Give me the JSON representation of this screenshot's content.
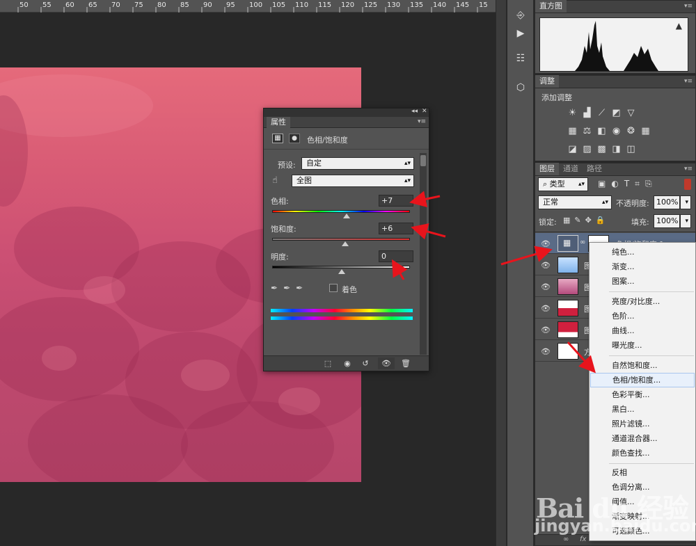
{
  "ruler": {
    "ticks": [
      "50",
      "55",
      "60",
      "65",
      "70",
      "75",
      "80",
      "85",
      "90",
      "95",
      "100",
      "105",
      "110",
      "115",
      "120",
      "125",
      "130",
      "135",
      "140",
      "145",
      "15"
    ]
  },
  "histogram_panel": {
    "tab": "直方图",
    "warning_icon": "warning-icon"
  },
  "adjustments_panel": {
    "tab": "调整",
    "heading": "添加调整"
  },
  "layers_panel": {
    "tabs": [
      "图层",
      "通道",
      "路径"
    ],
    "filter_type": "类型",
    "blend_mode": "正常",
    "opacity_label": "不透明度:",
    "opacity_value": "100%",
    "lock_label": "锁定:",
    "fill_label": "填充:",
    "fill_value": "100%",
    "selected_layer_name": "色相/饱和度 1",
    "layer_names": [
      "图",
      "图",
      "图",
      "图",
      "方"
    ]
  },
  "properties_panel": {
    "tab": "属性",
    "title": "色相/饱和度",
    "preset_label": "预设:",
    "preset_value": "自定",
    "range_value": "全图",
    "hue_label": "色相:",
    "hue_value": "+7",
    "saturation_label": "饱和度:",
    "saturation_value": "+6",
    "lightness_label": "明度:",
    "lightness_value": "0",
    "colorize_label": "着色"
  },
  "context_menu": {
    "group1": [
      "纯色...",
      "渐变...",
      "图案..."
    ],
    "group2": [
      "亮度/对比度...",
      "色阶...",
      "曲线...",
      "曝光度..."
    ],
    "group3": [
      "自然饱和度...",
      "色相/饱和度...",
      "色彩平衡...",
      "黑白...",
      "照片滤镜...",
      "通道混合器...",
      "颜色查找..."
    ],
    "group4": [
      "反相",
      "色调分离...",
      "阈值...",
      "渐变映射...",
      "可选颜色..."
    ],
    "highlighted": "色相/饱和度..."
  },
  "watermark": {
    "text": "Bai du 经验",
    "url": "jingyan.baidu.com"
  },
  "colors": {
    "canvas_pink": "#d85b75",
    "annotation_red": "#e8141c",
    "menu_highlight": "#e8f0fb"
  }
}
